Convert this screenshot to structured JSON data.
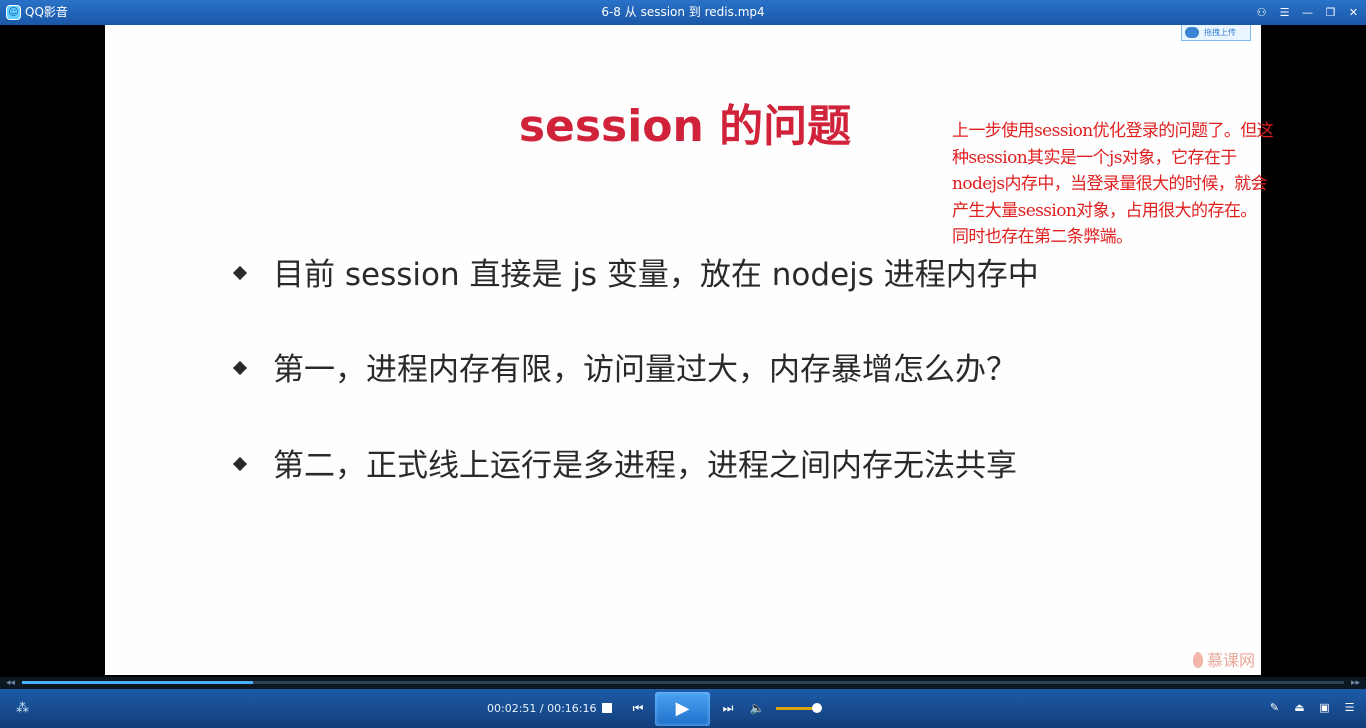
{
  "window": {
    "app_name": "QQ影音",
    "title": "6-8 从 session 到 redis.mp4",
    "controls": [
      "⚇",
      "☰",
      "—",
      "❐",
      "✕"
    ]
  },
  "slide": {
    "title": "session 的问题",
    "bullets": [
      "目前 session 直接是 js 变量，放在 nodejs 进程内存中",
      "第一，进程内存有限，访问量过大，内存暴增怎么办？",
      "第二，正式线上运行是多进程，进程之间内存无法共享"
    ],
    "upload_badge": "拖拽上传",
    "watermark": "慕课网"
  },
  "annotation": {
    "lines": [
      "上一步使用session优化登录的问题了。但这",
      "种session其实是一个js对象，它存在于",
      "nodejs内存中，当登录量很大的时候，就会",
      "产生大量session对象，占用很大的存在。",
      "同时也存在第二条弊端。"
    ],
    "color": "#e02020"
  },
  "player": {
    "time_display": "00:02:51 / 00:16:16",
    "progress": 0.175,
    "volume": 0.85,
    "seek_back": "◂◂",
    "seek_forward": "▸▸"
  }
}
